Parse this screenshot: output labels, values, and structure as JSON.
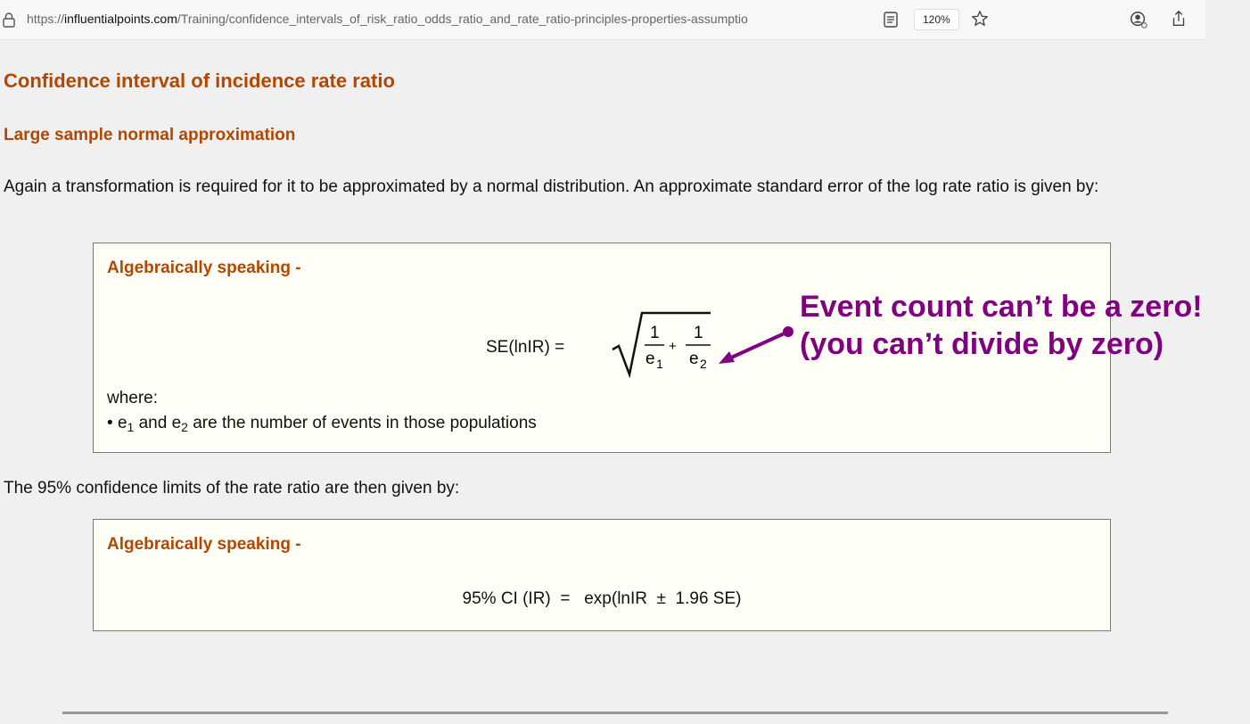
{
  "browser": {
    "url_prefix": "https://",
    "url_domain": "influentialpoints.com",
    "url_path": "/Training/confidence_intervals_of_risk_ratio_odds_ratio_and_rate_ratio-principles-properties-assumptio",
    "zoom": "120%",
    "icons": [
      "lock-icon",
      "reader-view-icon",
      "star-icon",
      "account-icon",
      "share-icon"
    ]
  },
  "page": {
    "title": "Confidence interval of incidence rate ratio",
    "subtitle": "Large sample normal approximation",
    "intro": "Again a transformation is required for it to be approximated by a normal distribution. An approximate standard error of the log rate ratio is given by:",
    "box1": {
      "heading": "Algebraically speaking -",
      "formula_label": "SE(lnIR)   =",
      "frac1_num": "1",
      "frac1_den": "e",
      "frac1_sub": "1",
      "plus": "+",
      "frac2_num": "1",
      "frac2_den": "e",
      "frac2_sub": "2",
      "where": "where:",
      "bullet_mark": "•",
      "bullet_e1": "e",
      "bullet_e1_sub": "1",
      "bullet_and": " and ",
      "bullet_e2": "e",
      "bullet_e2_sub": "2",
      "bullet_rest": " are the number of events in those populations"
    },
    "limits_text": "The 95% confidence limits of the rate ratio are then given by:",
    "box2": {
      "heading": "Algebraically speaking -",
      "formula": "95% CI (IR)  =   exp(lnIR  ±  1.96 SE)"
    }
  },
  "annotation": {
    "line1": "Event count can’t be a zero!",
    "line2": "(you can’t divide by zero)",
    "color": "#800080"
  }
}
